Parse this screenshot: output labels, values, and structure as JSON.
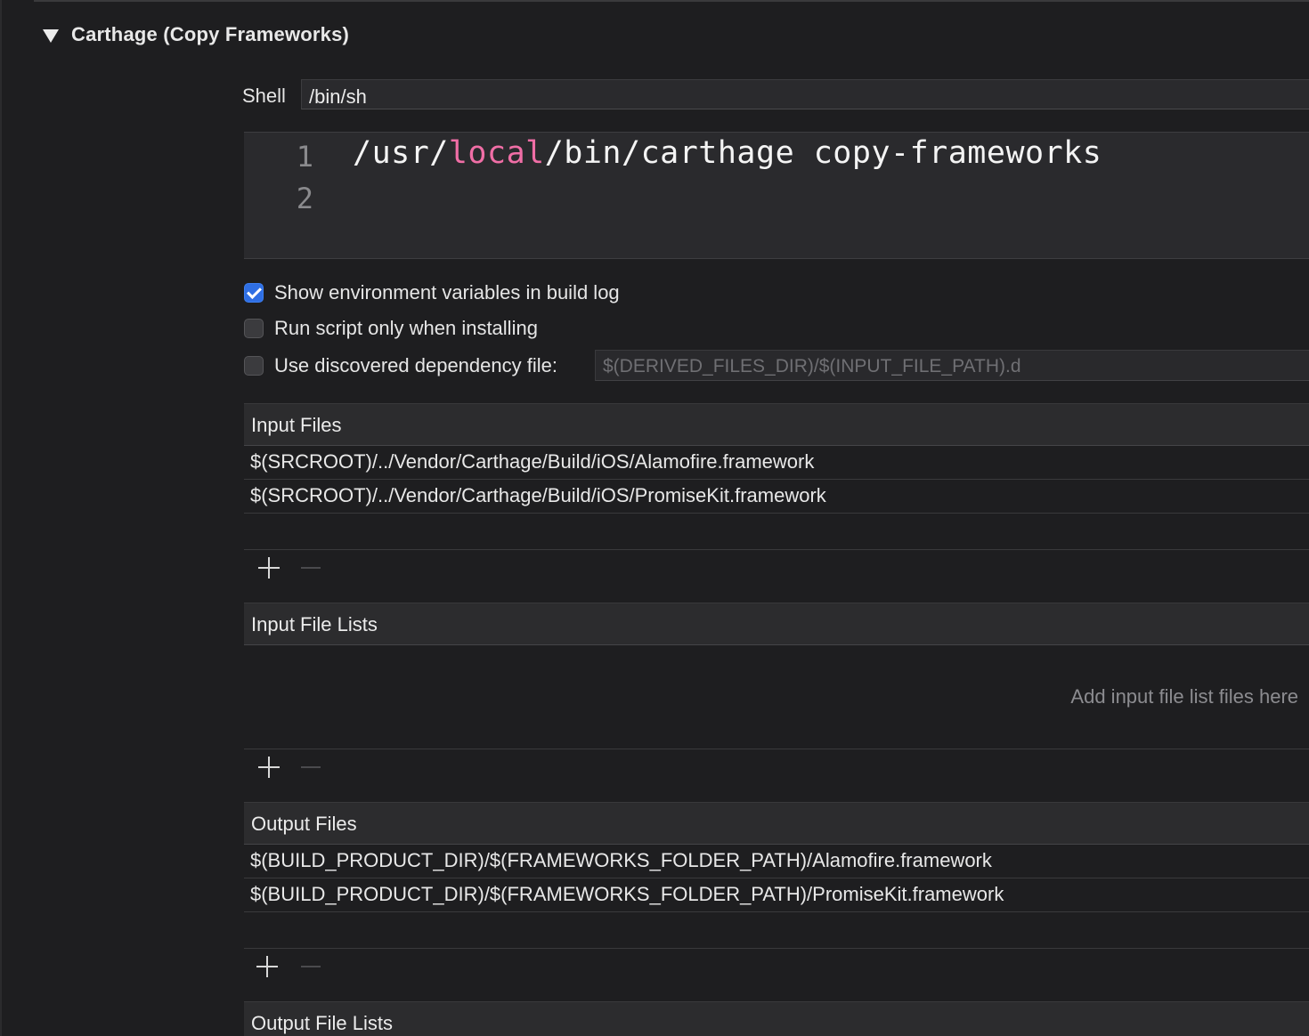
{
  "phase": {
    "title": "Carthage (Copy Frameworks)"
  },
  "shell": {
    "label": "Shell",
    "value": "/bin/sh"
  },
  "script": {
    "line_numbers": [
      "1",
      "2"
    ],
    "line1": {
      "part1": "/usr/",
      "keyword": "local",
      "part2": "/bin/carthage copy-frameworks"
    }
  },
  "options": {
    "show_env": {
      "label": "Show environment variables in build log",
      "checked": true
    },
    "run_only_installing": {
      "label": "Run script only when installing",
      "checked": false
    },
    "dependency_file": {
      "label": "Use discovered dependency file:",
      "checked": false,
      "placeholder": "$(DERIVED_FILES_DIR)/$(INPUT_FILE_PATH).d"
    }
  },
  "input_files": {
    "title": "Input Files",
    "items": [
      "$(SRCROOT)/../Vendor/Carthage/Build/iOS/Alamofire.framework",
      "$(SRCROOT)/../Vendor/Carthage/Build/iOS/PromiseKit.framework"
    ]
  },
  "input_file_lists": {
    "title": "Input File Lists",
    "empty_hint": "Add input file list files here"
  },
  "output_files": {
    "title": "Output Files",
    "items": [
      "$(BUILD_PRODUCT_DIR)/$(FRAMEWORKS_FOLDER_PATH)/Alamofire.framework",
      "$(BUILD_PRODUCT_DIR)/$(FRAMEWORKS_FOLDER_PATH)/PromiseKit.framework"
    ]
  },
  "output_file_lists": {
    "title": "Output File Lists"
  },
  "colors": {
    "background": "#1e1e20",
    "accent": "#2f6fe4",
    "keyword": "#f06ea6"
  }
}
